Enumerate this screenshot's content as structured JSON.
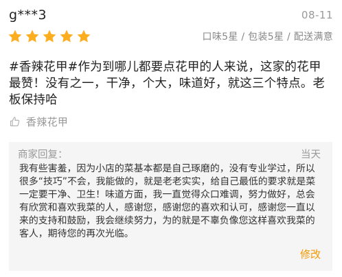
{
  "review": {
    "username": "g***3",
    "date": "08-11",
    "rating": 5,
    "star_color": "#fdae20",
    "scores": "口味5星 / 包装5星 / 配送满意",
    "text": "#香辣花甲#作为到哪儿都要点花甲的人来说，这家的花甲最赞！没有之一，干净，个大，味道好，就这三个特点。老板保持哈",
    "dish_icon": "thumbs-up-icon",
    "dish": "香辣花甲"
  },
  "reply": {
    "title": "商家回复：",
    "time": "当天",
    "text": "我有些害羞，因为小店的菜基本都是自己琢磨的，没有专业学过，所以很多“技巧”不会，我能做的，就是老老实实，给自己最低的要求就是菜一定要干净、卫生！味道方面，我一直觉得众口难调，努力做好，总会有欣赏和喜欢我菜的人，感谢您，感谢您的喜欢和认可，感谢您一直以来的支持和鼓励，我会继续努力，为的就是不辜负像您这样喜欢我菜的客人，期待您的再次光临。",
    "edit_label": "修改",
    "edit_color": "#f39800"
  }
}
